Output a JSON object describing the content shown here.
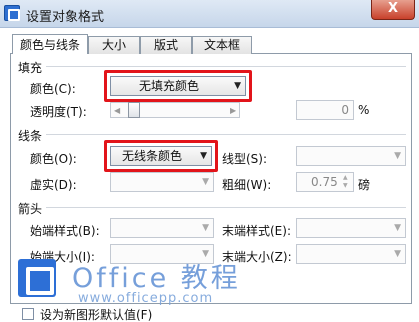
{
  "window": {
    "title": "设置对象格式",
    "close_symbol": "X"
  },
  "tabs": [
    {
      "label": "颜色与线条"
    },
    {
      "label": "大小"
    },
    {
      "label": "版式"
    },
    {
      "label": "文本框"
    }
  ],
  "fill": {
    "section_title": "填充",
    "color_label": "颜色(C):",
    "color_value": "无填充颜色",
    "transparency_label": "透明度(T):",
    "transparency_value": "0",
    "transparency_unit": "%"
  },
  "line": {
    "section_title": "线条",
    "color_label": "颜色(O):",
    "color_value": "无线条颜色",
    "style_label": "线型(S):",
    "dash_label": "虚实(D):",
    "weight_label": "粗细(W):",
    "weight_value": "0.75",
    "weight_unit": "磅"
  },
  "arrows": {
    "section_title": "箭头",
    "begin_style_label": "始端样式(B):",
    "end_style_label": "末端样式(E):",
    "begin_size_label": "始端大小(I):",
    "end_size_label": "末端大小(Z):"
  },
  "default_checkbox_label": "设为新图形默认值(F)",
  "watermark": {
    "main": "Office 教程",
    "sub": "www.officepp.com"
  },
  "colors": {
    "highlight": "#e2141a",
    "title_bar": "#c6d6ea"
  },
  "icons": {
    "app": "wps-app-icon",
    "caret": "chevron-down-icon",
    "logo": "office-logo-icon"
  }
}
